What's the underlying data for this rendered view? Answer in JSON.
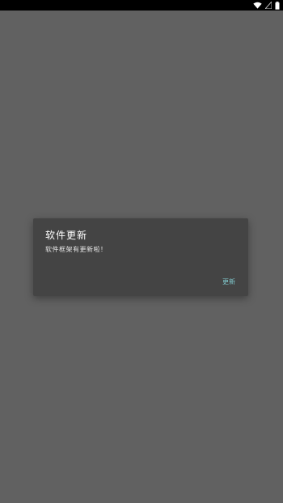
{
  "status_bar": {
    "icons": [
      "wifi-icon",
      "signal-icon",
      "battery-icon"
    ]
  },
  "dialog": {
    "title": "软件更新",
    "message": "软件框架有更新啦！",
    "confirm_label": "更新"
  },
  "colors": {
    "background": "#616161",
    "dialog_background": "#444444",
    "accent": "#7fc7cc"
  }
}
